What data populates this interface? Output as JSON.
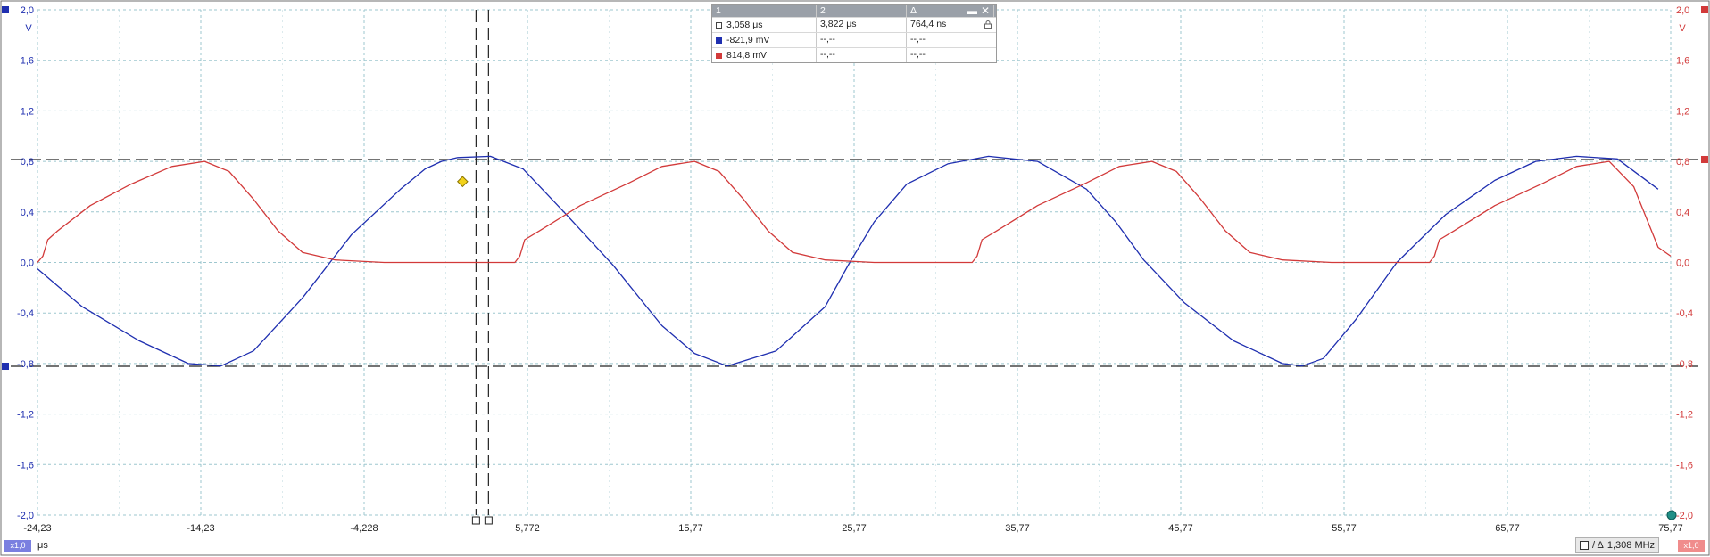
{
  "chart_data": {
    "type": "line",
    "title": "",
    "xlabel": "μs",
    "x_unit": "μs",
    "xlim": [
      -24.23,
      75.77
    ],
    "x_ticks": [
      "-24,23",
      "-14,23",
      "-4,228",
      "5,772",
      "15,77",
      "25,77",
      "35,77",
      "45,77",
      "55,77",
      "65,77",
      "75,77"
    ],
    "left_axis": {
      "unit": "V",
      "ylim": [
        -2.0,
        2.0
      ],
      "ticks": [
        "2,0",
        "1,6",
        "1,2",
        "0,8",
        "0,4",
        "0,0",
        "-0,4",
        "-0,8",
        "-1,2",
        "-1,6",
        "-2,0"
      ],
      "color": "#1f2fb0"
    },
    "right_axis": {
      "unit": "V",
      "ylim": [
        -2.0,
        2.0
      ],
      "ticks": [
        "2,0",
        "1,6",
        "1,2",
        "0,8",
        "0,4",
        "0,0",
        "-0,4",
        "-0,8",
        "-1,2",
        "-1,6",
        "-2,0"
      ],
      "color": "#d23a3a"
    },
    "grid": true,
    "series": [
      {
        "axis": "left",
        "color": "#1f2fb0",
        "x": [
          -24.23,
          -21.5,
          -18.0,
          -15.0,
          -13.0,
          -11.0,
          -8.0,
          -5.0,
          -2.0,
          -0.5,
          0.5,
          1.5,
          3.5,
          5.5,
          8.0,
          11.0,
          14.0,
          16.0,
          18.0,
          21.0,
          24.0,
          25.5,
          27.0,
          29.0,
          31.5,
          34.0,
          37.0,
          40.0,
          41.8,
          43.5,
          46.0,
          49.0,
          52.0,
          53.2,
          54.5,
          56.5,
          59.0,
          62.0,
          65.0,
          67.5,
          70.0,
          72.5,
          75.0
        ],
        "y": [
          -0.05,
          -0.35,
          -0.62,
          -0.8,
          -0.82,
          -0.7,
          -0.28,
          0.22,
          0.58,
          0.74,
          0.8,
          0.83,
          0.84,
          0.74,
          0.4,
          -0.02,
          -0.5,
          -0.72,
          -0.82,
          -0.7,
          -0.35,
          0.0,
          0.32,
          0.62,
          0.78,
          0.84,
          0.8,
          0.58,
          0.32,
          0.02,
          -0.32,
          -0.62,
          -0.8,
          -0.82,
          -0.76,
          -0.45,
          0.0,
          0.38,
          0.65,
          0.8,
          0.84,
          0.82,
          0.58
        ]
      },
      {
        "axis": "right",
        "color": "#d23a3a",
        "x": [
          -24.23,
          -23.9,
          -23.6,
          -23.0,
          -21.0,
          -18.5,
          -16.0,
          -14.0,
          -12.5,
          -11.0,
          -9.5,
          -8.0,
          -6.0,
          -3.0,
          0.0,
          3.0,
          5.0,
          5.3,
          5.6,
          6.5,
          9.0,
          12.0,
          14.0,
          16.0,
          17.5,
          19.0,
          20.5,
          22.0,
          24.0,
          27.0,
          30.0,
          33.0,
          33.3,
          33.6,
          34.5,
          37.0,
          40.0,
          42.0,
          44.0,
          45.5,
          47.0,
          48.5,
          50.0,
          52.0,
          55.0,
          58.0,
          61.0,
          61.3,
          61.6,
          62.5,
          65.0,
          68.0,
          70.0,
          72.0,
          73.5,
          75.0,
          75.77
        ],
        "y": [
          0.0,
          0.05,
          0.18,
          0.25,
          0.45,
          0.62,
          0.76,
          0.8,
          0.72,
          0.5,
          0.25,
          0.08,
          0.02,
          0.0,
          0.0,
          0.0,
          0.0,
          0.05,
          0.18,
          0.25,
          0.45,
          0.63,
          0.76,
          0.8,
          0.72,
          0.5,
          0.25,
          0.08,
          0.02,
          0.0,
          0.0,
          0.0,
          0.05,
          0.18,
          0.25,
          0.45,
          0.63,
          0.76,
          0.8,
          0.72,
          0.5,
          0.25,
          0.08,
          0.02,
          0.0,
          0.0,
          0.0,
          0.05,
          0.18,
          0.25,
          0.45,
          0.63,
          0.76,
          0.8,
          0.6,
          0.12,
          0.05
        ]
      }
    ],
    "h_cursors": [
      0.8149,
      -0.8219
    ],
    "v_cursors": [
      3.058,
      3.822
    ],
    "marker_point": {
      "x": 1.8,
      "y": 0.64,
      "color": "#f2d21b"
    }
  },
  "measurement_table": {
    "headers": [
      "1",
      "2",
      "Δ"
    ],
    "rows": [
      {
        "swatch": "white",
        "c1": "3,058 μs",
        "c2": "3,822 μs",
        "c3": "764,4 ns"
      },
      {
        "swatch": "#1f2fb0",
        "c1": "-821,9 mV",
        "c2": "--,--",
        "c3": "--,--"
      },
      {
        "swatch": "#d23a3a",
        "c1": "814,8 mV",
        "c2": "--,--",
        "c3": "--,--"
      }
    ],
    "minimize_glyph": "▬",
    "close_glyph": "✕",
    "lock_icon": "lock-icon"
  },
  "bottom_bar": {
    "left_badge": "x1,0",
    "x_unit": "μs",
    "trigger_label": "/ Δ",
    "frequency": "1,308 MHz",
    "right_badge": "x1,0"
  },
  "colors": {
    "channel_a": "#1f2fb0",
    "channel_b": "#d23a3a",
    "grid": "#9ec7cf"
  }
}
